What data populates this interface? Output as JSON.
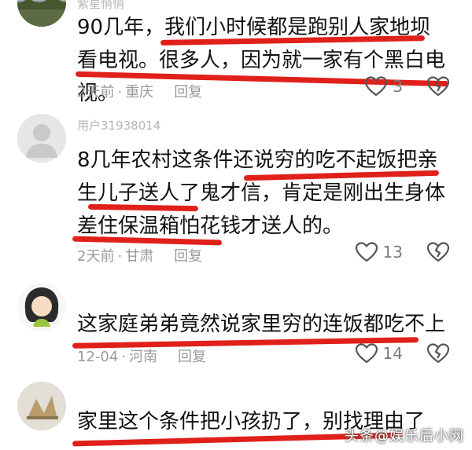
{
  "comments": [
    {
      "username": "紫星悄悄",
      "text": "90几年，我们小时候都是跑别人家地坝看电视。很多人，因为就一家有个黑白电视。",
      "time": "2天前",
      "location": "重庆",
      "reply": "回复",
      "likes": "3"
    },
    {
      "username": "用户31938014",
      "text": "8几年农村这条件还说穷的吃不起饭把亲生儿子送人了鬼才信，肯定是刚出生身体差住保温箱怕花钱才送人的。",
      "time": "2天前",
      "location": "甘肃",
      "reply": "回复",
      "likes": "13"
    },
    {
      "username": "",
      "text": "这家庭弟弟竟然说家里穷的连饭都吃不上",
      "time": "12-04",
      "location": "河南",
      "reply": "回复",
      "likes": "14"
    },
    {
      "username": "",
      "text": "家里这个条件把小孩扔了，别找理由了",
      "time": "",
      "location": "",
      "reply": "回复",
      "likes": ""
    }
  ],
  "watermark": "头条@娱乐后小网",
  "colors": {
    "highlight": "#e0201b",
    "meta": "#9a9a9a"
  },
  "icons": {
    "like": "heart-outline-icon",
    "dislike": "broken-heart-icon"
  }
}
